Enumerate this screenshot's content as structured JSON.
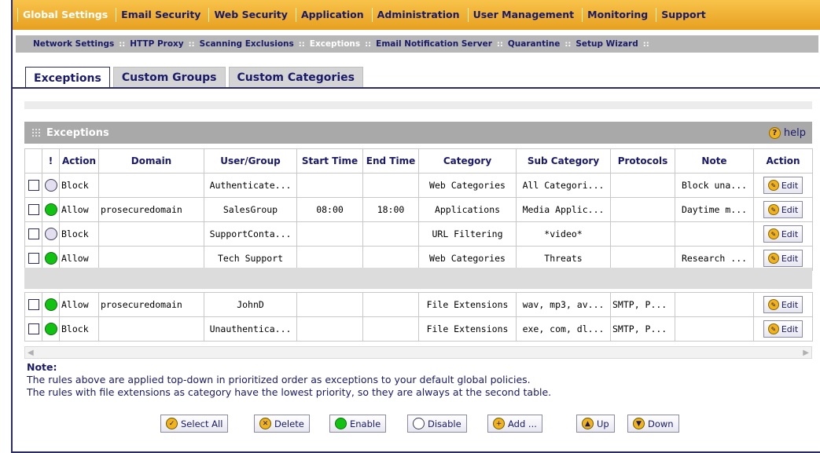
{
  "top_nav": {
    "items": [
      {
        "label": "Global Settings",
        "active": true
      },
      {
        "label": "Email Security",
        "active": false
      },
      {
        "label": "Web Security",
        "active": false
      },
      {
        "label": "Application",
        "active": false
      },
      {
        "label": "Administration",
        "active": false
      },
      {
        "label": "User Management",
        "active": false
      },
      {
        "label": "Monitoring",
        "active": false
      },
      {
        "label": "Support",
        "active": false
      }
    ]
  },
  "sub_nav": {
    "items": [
      {
        "label": "Network Settings",
        "active": false
      },
      {
        "label": "HTTP Proxy",
        "active": false
      },
      {
        "label": "Scanning Exclusions",
        "active": false
      },
      {
        "label": "Exceptions",
        "active": true
      },
      {
        "label": "Email Notification Server",
        "active": false
      },
      {
        "label": "Quarantine",
        "active": false
      },
      {
        "label": "Setup Wizard",
        "active": false
      }
    ]
  },
  "tabs": [
    {
      "label": "Exceptions",
      "active": true
    },
    {
      "label": "Custom Groups",
      "active": false
    },
    {
      "label": "Custom Categories",
      "active": false
    }
  ],
  "panel": {
    "title": "Exceptions",
    "help_label": "help",
    "help_glyph": "?",
    "columns": [
      "",
      "!",
      "Action",
      "Domain",
      "User/Group",
      "Start Time",
      "End Time",
      "Category",
      "Sub Category",
      "Protocols",
      "Note",
      "Action"
    ],
    "edit_label": "Edit",
    "rows": [
      {
        "status": "off",
        "action": "Block",
        "domain": "",
        "user": "Authenticate...",
        "start": "",
        "end": "",
        "category": "Web Categories",
        "sub": "All Categori...",
        "protocols": "",
        "note": "Block una..."
      },
      {
        "status": "on",
        "action": "Allow",
        "domain": "prosecuredomain",
        "user": "SalesGroup",
        "start": "08:00",
        "end": "18:00",
        "category": "Applications",
        "sub": "Media Applic...",
        "protocols": "",
        "note": "Daytime m..."
      },
      {
        "status": "off",
        "action": "Block",
        "domain": "",
        "user": "SupportConta...",
        "start": "",
        "end": "",
        "category": "URL Filtering",
        "sub": "*video*",
        "protocols": "",
        "note": ""
      },
      {
        "status": "on",
        "action": "Allow",
        "domain": "",
        "user": "Tech Support",
        "start": "",
        "end": "",
        "category": "Web Categories",
        "sub": "Threats",
        "protocols": "",
        "note": "Research ..."
      }
    ],
    "rows2": [
      {
        "status": "on",
        "action": "Allow",
        "domain": "prosecuredomain",
        "user": "JohnD",
        "start": "",
        "end": "",
        "category": "File Extensions",
        "sub": "wav, mp3, av...",
        "protocols": "SMTP, P...",
        "note": ""
      },
      {
        "status": "on",
        "action": "Block",
        "domain": "",
        "user": "Unauthentica...",
        "start": "",
        "end": "",
        "category": "File Extensions",
        "sub": "exe, com, dl...",
        "protocols": "SMTP, P...",
        "note": ""
      }
    ]
  },
  "note": {
    "heading": "Note:",
    "line1": "The rules above are applied top-down in prioritized order as exceptions to your default global policies.",
    "line2": "The rules with file extensions as category have the lowest priority, so they are always at the second table."
  },
  "buttons": {
    "select_all": "Select All",
    "delete": "Delete",
    "enable": "Enable",
    "disable": "Disable",
    "add": "Add ...",
    "up": "Up",
    "down": "Down"
  },
  "icons": {
    "select_all": "checkmark-icon",
    "delete": "x-circle-icon",
    "enable": "green-dot-icon",
    "disable": "white-dot-icon",
    "add": "plus-circle-icon",
    "up": "up-arrow-icon",
    "down": "down-arrow-icon"
  },
  "colors": {
    "nav_bg": "#e7a020",
    "nav_text": "#1a1a6b",
    "panel_header": "#a9a9a9",
    "enabled": "#12c212",
    "button_accent": "#f2b21c"
  }
}
